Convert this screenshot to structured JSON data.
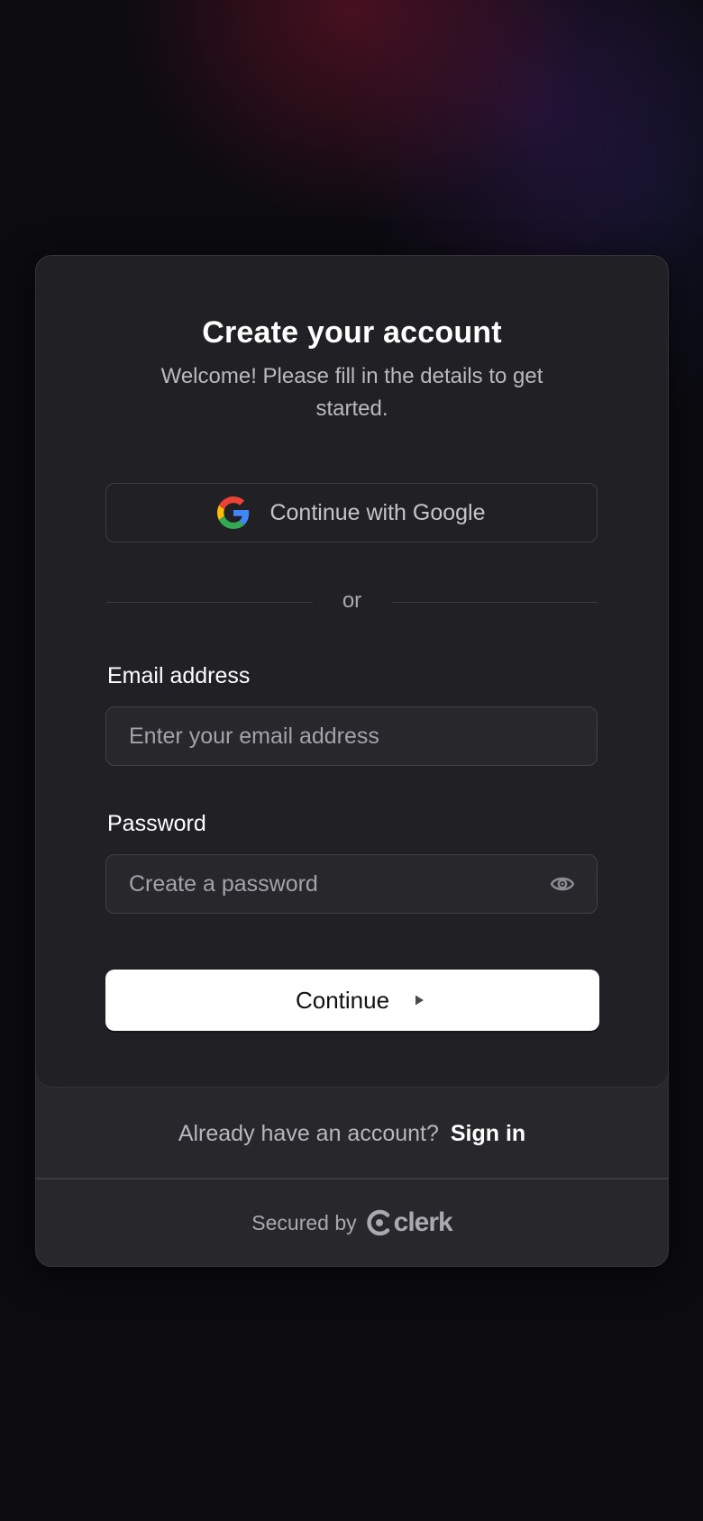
{
  "header": {
    "title": "Create your account",
    "subtitle": "Welcome! Please fill in the details to get started."
  },
  "social": {
    "google_label": "Continue with Google",
    "google_icon": "google-g-icon"
  },
  "divider": {
    "text": "or"
  },
  "form": {
    "email": {
      "label": "Email address",
      "value": "",
      "placeholder": "Enter your email address"
    },
    "password": {
      "label": "Password",
      "value": "",
      "placeholder": "Create a password",
      "toggle_icon": "eye-icon"
    },
    "submit_label": "Continue",
    "submit_icon": "play-triangle-icon"
  },
  "footer": {
    "prompt": "Already have an account?",
    "signin_label": "Sign in",
    "secured_text": "Secured by",
    "brand": "clerk"
  },
  "colors": {
    "page_background": "#0b0b10",
    "card_background": "#212125",
    "footer_background": "#27272c",
    "primary_button": "#ffffff",
    "accent_text": "#ffffff",
    "muted_text": "#b9b9bf"
  }
}
